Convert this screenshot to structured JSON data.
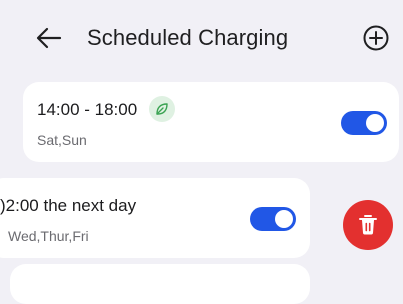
{
  "header": {
    "title": "Scheduled Charging",
    "back_icon": "arrow-left-icon",
    "add_icon": "plus-circle-icon"
  },
  "schedules": [
    {
      "time": "14:00 - 18:00",
      "days": "Sat,Sun",
      "eco_icon": "leaf-icon",
      "enabled": true
    },
    {
      "time": ")2:00 the next day",
      "days": "Wed,Thur,Fri",
      "enabled": true
    }
  ],
  "delete_icon": "trash-icon",
  "colors": {
    "background": "#f1f0f6",
    "card": "#ffffff",
    "toggle_on": "#2157e6",
    "delete": "#e3302f",
    "eco_badge": "#dff1e2",
    "eco_leaf": "#3aa352"
  }
}
